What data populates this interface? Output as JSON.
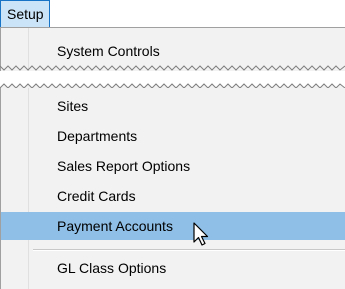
{
  "menubar": {
    "active_menu": "Setup"
  },
  "menu": {
    "top_items": [
      {
        "label": "System Controls"
      }
    ],
    "items": [
      {
        "label": "Sites"
      },
      {
        "label": "Departments"
      },
      {
        "label": "Sales Report Options"
      },
      {
        "label": "Credit Cards"
      },
      {
        "label": "Payment Accounts",
        "highlighted": true
      },
      {
        "label": "GL Class Options"
      }
    ]
  },
  "colors": {
    "highlight": "#8fbfe6",
    "menu_background": "#f2f2f2",
    "tab_background": "#cce4f7",
    "tab_border": "#1673c6"
  },
  "icons": {
    "cursor": "arrow-pointer-icon"
  }
}
